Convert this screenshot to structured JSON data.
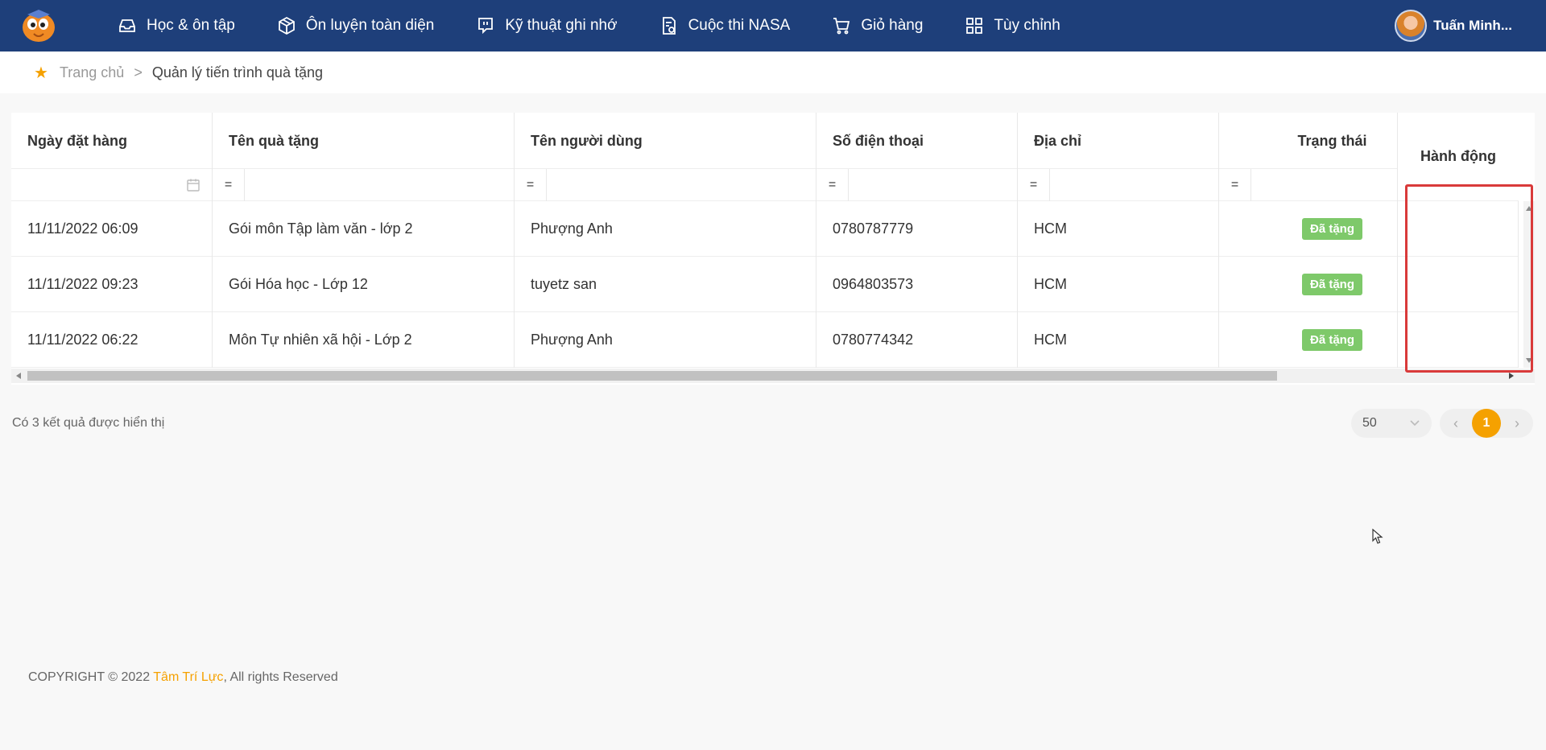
{
  "nav": {
    "items": [
      {
        "label": "Học & ôn tập",
        "icon": "inbox-icon"
      },
      {
        "label": "Ôn luyện toàn diện",
        "icon": "cube-icon"
      },
      {
        "label": "Kỹ thuật ghi nhớ",
        "icon": "chat-icon"
      },
      {
        "label": "Cuộc thi NASA",
        "icon": "document-icon"
      },
      {
        "label": "Giỏ hàng",
        "icon": "cart-icon"
      },
      {
        "label": "Tùy chỉnh",
        "icon": "grid-icon"
      }
    ],
    "user_name": "Tuấn Minh..."
  },
  "breadcrumb": {
    "home": "Trang chủ",
    "separator": ">",
    "current": "Quản lý tiến trình quà tặng"
  },
  "table": {
    "headers": {
      "date": "Ngày đặt hàng",
      "gift": "Tên quà tặng",
      "user": "Tên người dùng",
      "phone": "Số điện thoại",
      "address": "Địa chỉ",
      "status": "Trạng thái",
      "action": "Hành động"
    },
    "filter_operator": "=",
    "rows": [
      {
        "date": "11/11/2022 06:09",
        "gift": "Gói môn Tập làm văn - lớp 2",
        "user": "Phượng Anh",
        "phone": "0780787779",
        "address": "HCM",
        "status": "Đã tặng"
      },
      {
        "date": "11/11/2022 09:23",
        "gift": "Gói Hóa học - Lớp 12",
        "user": "tuyetz san",
        "phone": "0964803573",
        "address": "HCM",
        "status": "Đã tặng"
      },
      {
        "date": "11/11/2022 06:22",
        "gift": "Môn Tự nhiên xã hội - Lớp 2",
        "user": "Phượng Anh",
        "phone": "0780774342",
        "address": "HCM",
        "status": "Đã tặng"
      }
    ]
  },
  "result_text": "Có 3 kết quả được hiển thị",
  "pagination": {
    "page_size": "50",
    "prev": "‹",
    "current_page": "1",
    "next": "›"
  },
  "footer": {
    "prefix": "COPYRIGHT © 2022 ",
    "brand": "Tâm Trí Lực",
    "suffix": ", All rights Reserved"
  },
  "colors": {
    "navbar": "#1e3f7a",
    "accent": "#f5a100",
    "badge": "#7ec96a",
    "highlight": "#d93a3a"
  }
}
